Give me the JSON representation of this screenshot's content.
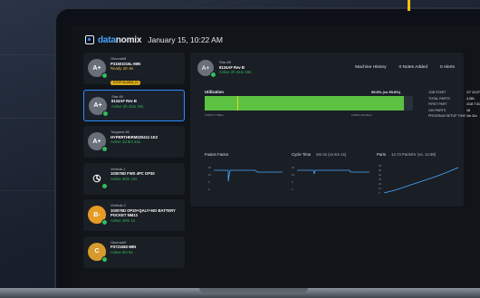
{
  "header": {
    "brand_prefix": "data",
    "brand_suffix": "nomix",
    "datetime": "January 15, 10:22 AM"
  },
  "machines": [
    {
      "initials": "A+",
      "name": "Okuma#8",
      "job": "P31501015L-MIN",
      "status": "Ready 3m 6s",
      "status_type": "ready",
      "tag": "STOP ALARM_O",
      "avatar": "gray"
    },
    {
      "initials": "A+",
      "name": "Star-60",
      "job": "8134AF Rev B",
      "status": "Active 2h 41m 19s",
      "status_type": "active",
      "tag": "",
      "avatar": "gray",
      "active": true
    },
    {
      "initials": "A+",
      "name": "Tsugami-36",
      "job": "HYPERTHERM220411-1K2",
      "status": "Active 1d 6m 34s",
      "status_type": "active",
      "tag": "",
      "avatar": "gray"
    },
    {
      "initials": "",
      "name": "Vertical-1",
      "job": "103076D FWS 4PC OP30",
      "status": "Active 40m 12s",
      "status_type": "active",
      "tag": "",
      "avatar": "icon"
    },
    {
      "initials": "B-",
      "name": "Vertical-2",
      "job": "103076D OP20+QALY+NO BATTERY POCKET NM13",
      "status": "Active 19m 1s",
      "status_type": "active",
      "tag": "",
      "avatar": "orange"
    },
    {
      "initials": "C",
      "name": "Okuma#9",
      "job": "P3721582-MIN",
      "status": "Active 3m 5s",
      "status_type": "active",
      "tag": "",
      "avatar": "gold"
    }
  ],
  "detail": {
    "initials": "A+",
    "name": "Star-60",
    "job": "8134AF Rev B",
    "status": "Active 2h 41m 19s",
    "links": [
      "Machine History",
      "0 Notes Added",
      "0 Alerts"
    ],
    "utilization_label": "Utilization",
    "utilization_pct": "95.8% (vs 95.8%)",
    "utilization_value": 0.958,
    "util_start": "1/15/21 7:45am",
    "util_end": "1/15/21 10:22am",
    "stats": [
      {
        "k": "JOB START",
        "v": "1/7 12:07pm"
      },
      {
        "k": "TOTAL PARTS",
        "v": "4,081"
      },
      {
        "k": "FIRST PART",
        "v": "1/18 7:31am"
      },
      {
        "k": "24H PARTS",
        "v": "16"
      },
      {
        "k": "PROGRAM SETUP TIME",
        "v": "1m 11s"
      }
    ],
    "fusion_label": "Fusion Factor",
    "cycle_label": "Cycle Time",
    "cycle_sub": "6m 0s (vs 6m 1s)",
    "parts_label": "Parts",
    "parts_sub": "14.73 Parts/Hr (vs. 14.99)",
    "fusion_ticks": [
      "15",
      "10",
      "5",
      "0"
    ],
    "cycle_ticks": [
      "15",
      "10",
      "5",
      "0"
    ],
    "parts_ticks": [
      "60",
      "50",
      "40",
      "30",
      "20",
      "10",
      "0"
    ]
  },
  "colors": {
    "accent": "#2c8cff",
    "active_green": "#2fbe5d",
    "utilization_green": "#5cc242",
    "ready_yellow": "#e6c23a",
    "panel": "#1a1e25"
  }
}
